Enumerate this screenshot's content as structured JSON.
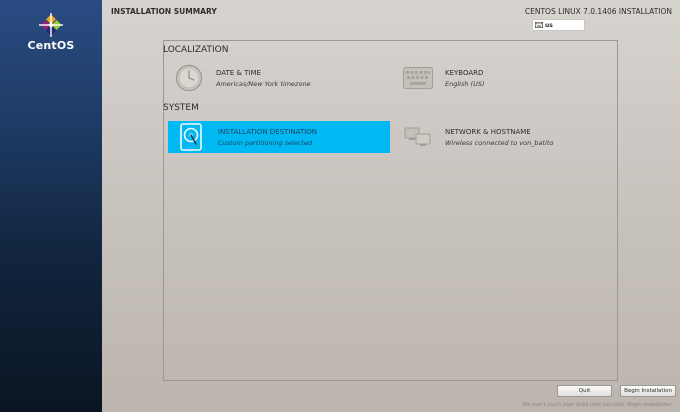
{
  "sidebar": {
    "brand": "CentOS"
  },
  "header": {
    "title": "INSTALLATION SUMMARY",
    "product": "CENTOS LINUX 7.0.1406 INSTALLATION",
    "keyboard_layout": "us"
  },
  "sections": {
    "localization": {
      "heading": "LOCALIZATION",
      "date_time": {
        "title": "DATE & TIME",
        "status": "Americas/New York timezone"
      },
      "keyboard": {
        "title": "KEYBOARD",
        "status": "English (US)"
      }
    },
    "system": {
      "heading": "SYSTEM",
      "installation_destination": {
        "title": "INSTALLATION DESTINATION",
        "status": "Custom partitioning selected"
      },
      "network_hostname": {
        "title": "NETWORK & HOSTNAME",
        "status": "Wireless connected to von_batito"
      }
    }
  },
  "buttons": {
    "quit": "Quit",
    "begin": "Begin Installation"
  },
  "footer_note": "We won't touch your disks until you click 'Begin Installation'.",
  "colors": {
    "selected_spoke": "#00b9f2",
    "sidebar_top": "#2a4c83",
    "sidebar_bottom": "#0b1522"
  }
}
